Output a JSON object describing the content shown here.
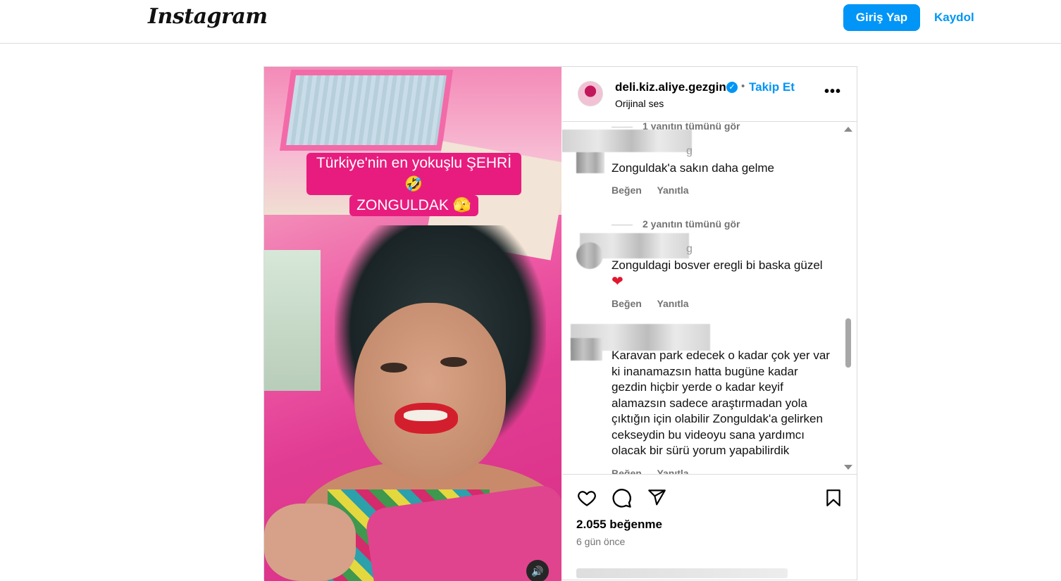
{
  "nav": {
    "logo_text": "Instagram",
    "login_label": "Giriş Yap",
    "signup_label": "Kaydol"
  },
  "colors": {
    "accent": "#0095f6",
    "border": "#dbdbdb",
    "muted": "#737373",
    "overlay_pink": "#e81c7e"
  },
  "post": {
    "video": {
      "caption_line1": "Türkiye'nin en yokuşlu ŞEHRİ 🤣",
      "caption_line2": "ZONGULDAK 🫣",
      "mute_icon": "volume-icon"
    },
    "header": {
      "username": "deli.kiz.aliye.gezgin",
      "verified_icon": "verified-badge-icon",
      "separator": "•",
      "follow_label": "Takip Et",
      "audio_label": "Orijinal ses",
      "more_icon": "more-options-icon"
    },
    "comments": [
      {
        "view_replies": "1 yanıtın tümünü gör"
      },
      {
        "username_tail": "g",
        "text": "Zonguldak'a sakın daha gelme",
        "like_label": "Beğen",
        "reply_label": "Yanıtla"
      },
      {
        "view_replies": "2 yanıtın tümünü gör"
      },
      {
        "username_tail": "g",
        "text": "Zonguldagi bosver eregli bi baska güzel",
        "emoji": "❤",
        "like_label": "Beğen",
        "reply_label": "Yanıtla"
      },
      {
        "text": "Karavan park edecek o kadar çok yer var ki inanamazsın hatta bugüne kadar gezdin hiçbir yerde o kadar keyif alamazsın sadece araştırmadan yola çıktığın için olabilir Zonguldak'a gelirken cekseydin bu videoyu sana yardımcı olacak bir sürü yorum yapabilirdik",
        "like_label": "Beğen",
        "reply_label": "Yanıtla"
      }
    ],
    "actions": {
      "like_icon": "heart-icon",
      "comment_icon": "comment-icon",
      "share_icon": "share-icon",
      "save_icon": "bookmark-icon"
    },
    "likes_text": "2.055 beğenme",
    "time_text": "6 gün önce"
  }
}
